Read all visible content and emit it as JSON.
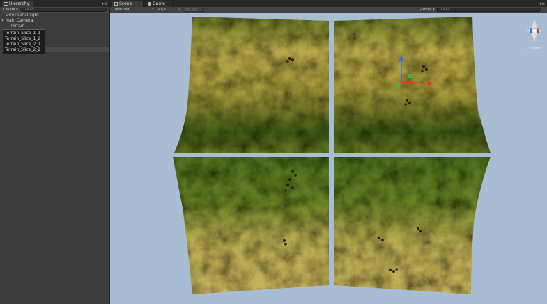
{
  "hierarchy": {
    "tab_label": "Hierarchy",
    "create_label": "Create ▾",
    "search_placeholder": "Q▾All",
    "items": [
      {
        "label": "Directional light"
      },
      {
        "label": "Main Camera"
      },
      {
        "label": "Terrain"
      }
    ],
    "selected_items": [
      {
        "label": "Terrain_Slice_1_1"
      },
      {
        "label": "Terrain_Slice_1_2"
      },
      {
        "label": "Terrain_Slice_2_1"
      },
      {
        "label": "Terrain_Slice_2_2"
      }
    ]
  },
  "scene": {
    "tab_scene": "Scene",
    "tab_game": "Game",
    "shading_mode": "Textured",
    "render_mode": "RGB",
    "gizmos_label": "Gizmos ▾",
    "search_placeholder": "Q▾All",
    "persp_label": "◁ Persp"
  },
  "colors": {
    "sky": "#a8bcd4",
    "terrain_sand": "#c2b255",
    "terrain_grass": "#4a6a1c",
    "axis_x": "#e03a2a",
    "axis_y": "#4ab83a",
    "axis_z": "#3a6ae0"
  }
}
